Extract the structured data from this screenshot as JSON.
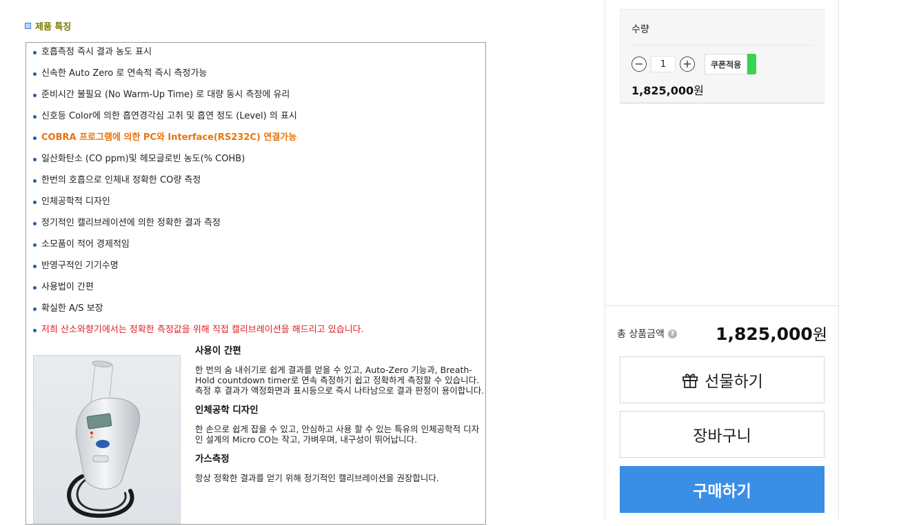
{
  "features": {
    "title": "제품 특징",
    "items": [
      {
        "text": "호흡측정 즉시 결과 농도 표시",
        "style": "normal"
      },
      {
        "text": "신속한 Auto Zero 로 연속적 즉시 측정가능",
        "style": "normal"
      },
      {
        "text": "준비시간 불필요 (No Warm-Up Time) 로 대량 동시 측정에 유리",
        "style": "normal"
      },
      {
        "text": "신호등 Color에 의한 흡연경각심 고취 및 흡연 정도 (Level) 의 표시",
        "style": "normal"
      },
      {
        "text": "COBRA 프로그램에 의한 PC와 Interface(RS232C) 연결가능",
        "style": "orange"
      },
      {
        "text": "일산화탄소 (CO ppm)및 헤모글로빈 농도(% COHB)",
        "style": "normal"
      },
      {
        "text": "한번의 호흡으로 인체내 정확한 CO량 측정",
        "style": "normal"
      },
      {
        "text": "인체공학적 디자인",
        "style": "normal"
      },
      {
        "text": "정기적인 캘리브레이션에 의한 정확한 결과 측정",
        "style": "normal"
      },
      {
        "text": "소모품이 적어 경제적임",
        "style": "normal"
      },
      {
        "text": "반영구적인 기기수명",
        "style": "normal"
      },
      {
        "text": "사용법이 간편",
        "style": "normal"
      },
      {
        "text": "확실한 A/S 보장",
        "style": "normal"
      },
      {
        "text": "저희 산소와향기에서는 정확한 측정값을 위해 직접 캘리브레이션을 해드리고 있습니다.",
        "style": "red"
      }
    ]
  },
  "details": {
    "sections": [
      {
        "heading": "사용이 간편",
        "body": "한 번의 숨 내쉬기로 쉽게 결과를 얻을 수 있고, Auto-Zero 기능과, Breath-Hold countdown timer로 연속 측정하기 쉽고 정확하게 측정할 수 있습니다. 측정 후 결과가 액정화면과 표시등으로 즉시 나타남으로 결과 판정이 용이합니다."
      },
      {
        "heading": "인체공학 디자인",
        "body": "한 손으로 쉽게 잡을 수 있고, 안심하고 사용 할 수 있는 특유의 인체공학적 디자인 설계의 Micro CO는 작고, 가벼우며, 내구성이 뛰어납니다."
      },
      {
        "heading": "가스측정",
        "body": "항상 정확한 결과를 얻기 위해 정기적인 캘리브레이션을 권장합니다."
      }
    ]
  },
  "option": {
    "qty_label": "수량",
    "minus": "−",
    "plus": "+",
    "qty_value": "1",
    "coupon_label": "쿠폰적용",
    "price": "1,825,000",
    "unit": "원"
  },
  "summary": {
    "total_label": "총 상품금액",
    "help": "?",
    "total_price": "1,825,000",
    "unit": "원"
  },
  "actions": {
    "gift": "선물하기",
    "cart": "장바구니",
    "buy": "구매하기"
  },
  "colors": {
    "buy_button": "#3a8ee6",
    "coupon_indicator": "#39d353",
    "highlight_orange": "#e8730a",
    "highlight_red": "#e02020"
  }
}
